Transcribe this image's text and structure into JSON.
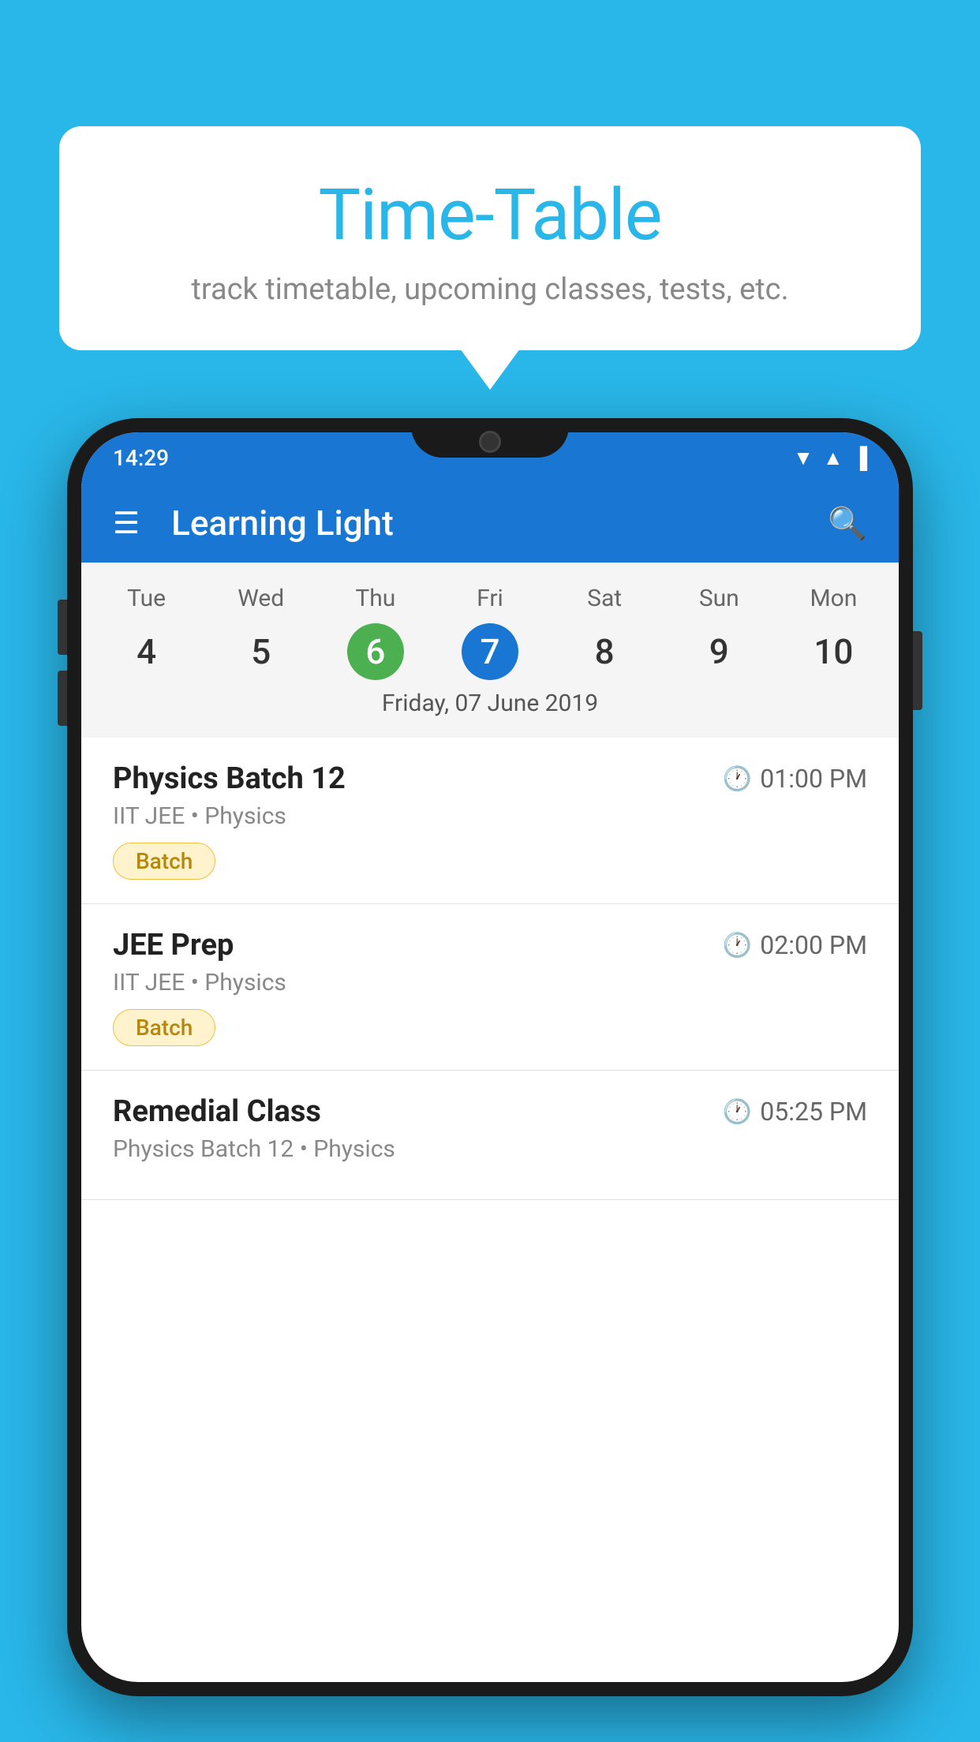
{
  "background_color": "#29B6E8",
  "bubble": {
    "title": "Time-Table",
    "subtitle": "track timetable, upcoming classes, tests, etc."
  },
  "phone": {
    "status_bar": {
      "time": "14:29"
    },
    "app_bar": {
      "title": "Learning Light"
    },
    "calendar": {
      "day_headers": [
        "Tue",
        "Wed",
        "Thu",
        "Fri",
        "Sat",
        "Sun",
        "Mon"
      ],
      "day_numbers": [
        "4",
        "5",
        "6",
        "7",
        "8",
        "9",
        "10"
      ],
      "today_index": 2,
      "selected_index": 3,
      "selected_date_label": "Friday, 07 June 2019"
    },
    "schedule": [
      {
        "title": "Physics Batch 12",
        "time": "01:00 PM",
        "subtitle": "IIT JEE • Physics",
        "tag": "Batch"
      },
      {
        "title": "JEE Prep",
        "time": "02:00 PM",
        "subtitle": "IIT JEE • Physics",
        "tag": "Batch"
      },
      {
        "title": "Remedial Class",
        "time": "05:25 PM",
        "subtitle": "Physics Batch 12 • Physics",
        "tag": ""
      }
    ]
  }
}
